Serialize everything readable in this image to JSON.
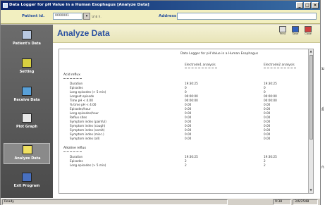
{
  "window": {
    "title": "Data Logger for pH Value in a Human Esophagus  [Analyze Data]",
    "controls": [
      "_",
      "□",
      "×"
    ]
  },
  "topbar": {
    "patient_id_label": "Patient id.",
    "patient_id_value": "0000001",
    "patient_name": "นาย ก.",
    "address_label": "Address",
    "address_value": ""
  },
  "sidebar": {
    "items": [
      {
        "label": "Patient's Data",
        "icon": "patient-card-icon",
        "color": "#b8c8e0"
      },
      {
        "label": "Setting",
        "icon": "settings-tools-icon",
        "color": "#d8d040"
      },
      {
        "label": "Receive Data",
        "icon": "receive-data-icon",
        "color": "#58a0d8"
      },
      {
        "label": "Plot Graph",
        "icon": "plot-graph-icon",
        "color": "#e8e8e8"
      },
      {
        "label": "Analyze Data",
        "icon": "analyze-data-icon",
        "color": "#f0e060"
      },
      {
        "label": "Exit Program",
        "icon": "exit-door-icon",
        "color": "#4870c0"
      }
    ],
    "active": "Analyze Data"
  },
  "main": {
    "title": "Analyze Data",
    "toolbar": [
      {
        "label": "Print",
        "icon": "print-icon"
      },
      {
        "label": "Save",
        "icon": "save-icon"
      },
      {
        "label": "Close",
        "icon": "close-icon"
      }
    ]
  },
  "report": {
    "title": "Data Logger for pH Value in a Human Esophagus",
    "columns": [
      "Electrode1 analysis",
      "Electrode2 analysis"
    ],
    "acid": {
      "header": "Acid reflux",
      "rows": [
        {
          "name": "Duration",
          "v1": "19:30:25",
          "v2": "19:30:25"
        },
        {
          "name": "Episodes",
          "v1": "0",
          "v2": "0"
        },
        {
          "name": "Long episodes (> 5 min)",
          "v1": "0",
          "v2": "0"
        },
        {
          "name": "Longest episode",
          "v1": "00:00:00",
          "v2": "00:00:00"
        },
        {
          "name": "Time pH < 4.00",
          "v1": "00:00:00",
          "v2": "00:00:00"
        },
        {
          "name": "% time pH < 4.00",
          "v1": "0.00",
          "v2": "0.00"
        },
        {
          "name": "Episodes/hour",
          "v1": "0.00",
          "v2": "0.00"
        },
        {
          "name": "Long episodes/hour",
          "v1": "0.00",
          "v2": "0.00"
        },
        {
          "name": "Reflux sites",
          "v1": "0.00",
          "v2": "0.00"
        },
        {
          "name": "Symptom index (painful)",
          "v1": "0.00",
          "v2": "0.00"
        },
        {
          "name": "Symptom index (cough)",
          "v1": "0.00",
          "v2": "0.00"
        },
        {
          "name": "Symptom index (vomit)",
          "v1": "0.00",
          "v2": "0.00"
        },
        {
          "name": "Symptom index (misc.)",
          "v1": "0.00",
          "v2": "0.00"
        },
        {
          "name": "Symptom index (all)",
          "v1": "0.00",
          "v2": "0.00"
        }
      ]
    },
    "alkaline": {
      "header": "Alkaline reflux",
      "rows": [
        {
          "name": "Duration",
          "v1": "19:30:25",
          "v2": "19:30:25"
        },
        {
          "name": "Episodes",
          "v1": "2",
          "v2": "2"
        },
        {
          "name": "Long episodes (> 5 min)",
          "v1": "2",
          "v2": "2"
        }
      ]
    }
  },
  "statusbar": {
    "left": "Ready",
    "time": "9:38",
    "date": "3/6/2548"
  },
  "side_glyphs": [
    "ม",
    "ย์",
    "ก"
  ]
}
